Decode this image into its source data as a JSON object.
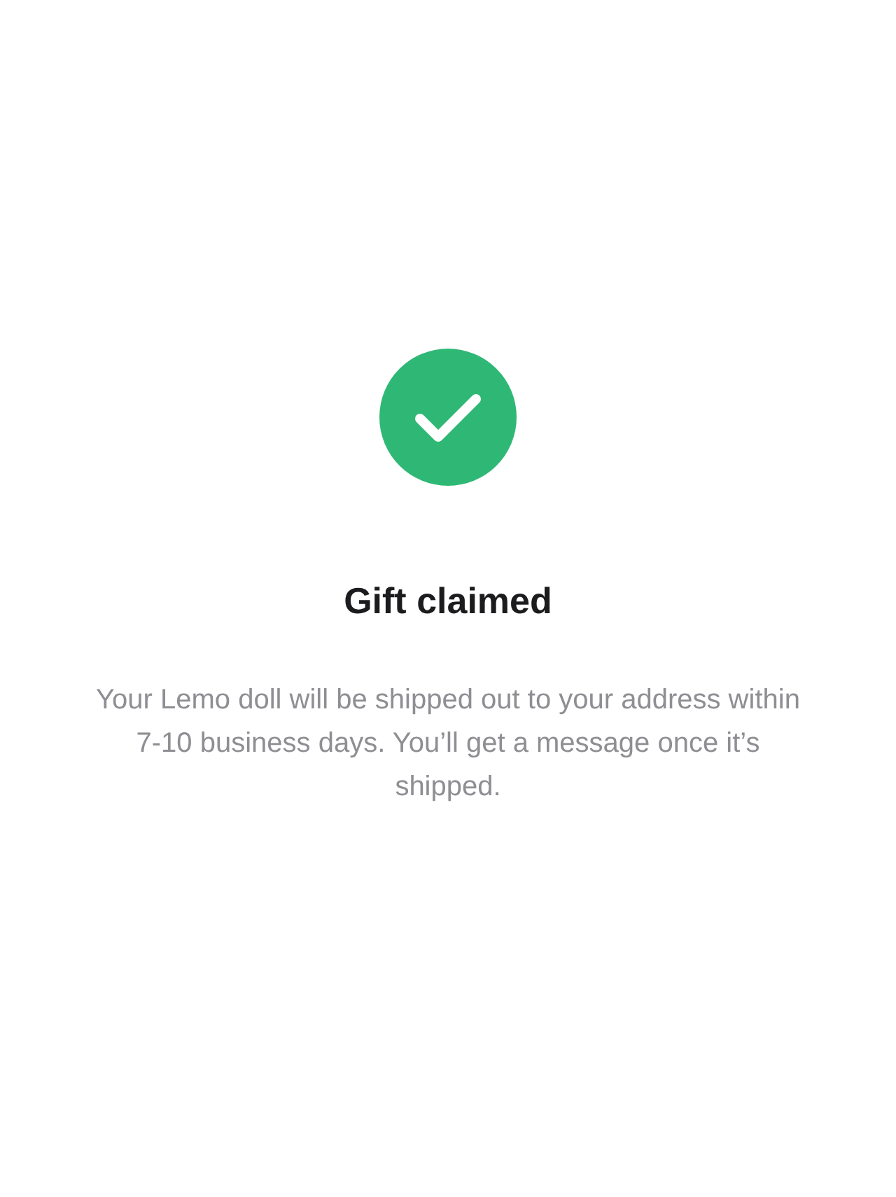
{
  "status": {
    "kind": "success"
  },
  "title": "Gift claimed",
  "message": "Your Lemo doll will be shipped out to your address within 7-10 business days. You’ll get a message once it’s shipped."
}
